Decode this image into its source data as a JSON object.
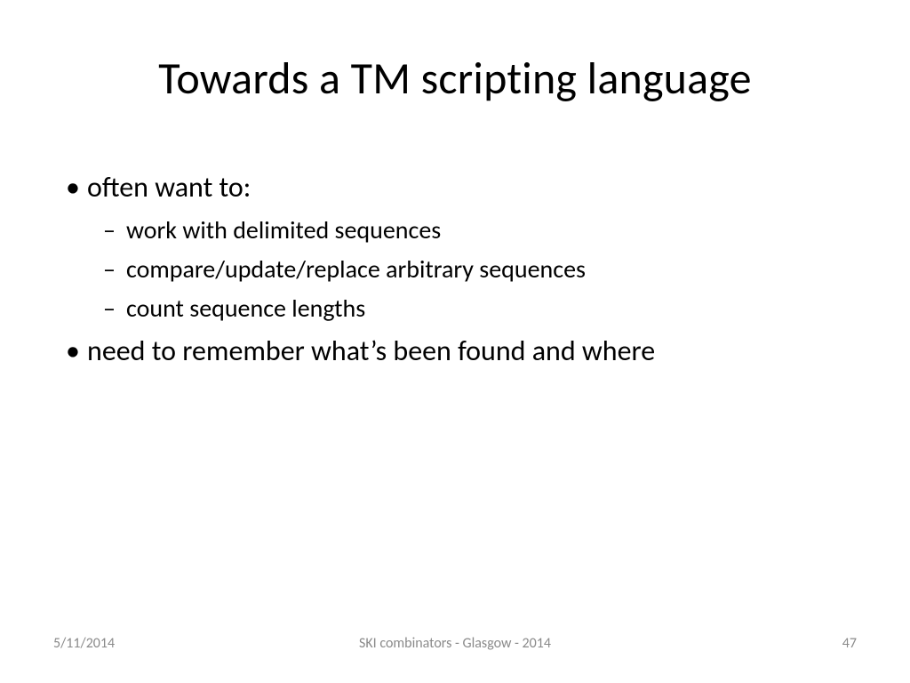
{
  "title": "Towards a TM scripting language",
  "bullets": {
    "lvl1": [
      {
        "text": "often want to:",
        "sub": [
          "work with delimited sequences",
          "compare/update/replace  arbitrary sequences",
          "count sequence lengths"
        ]
      },
      {
        "text": "need to remember what’s been found and where",
        "sub": []
      }
    ]
  },
  "footer": {
    "date": "5/11/2014",
    "center": "SKI combinators - Glasgow - 2014",
    "pageno": "47"
  },
  "glyphs": {
    "disc": "•",
    "dash": "–"
  }
}
